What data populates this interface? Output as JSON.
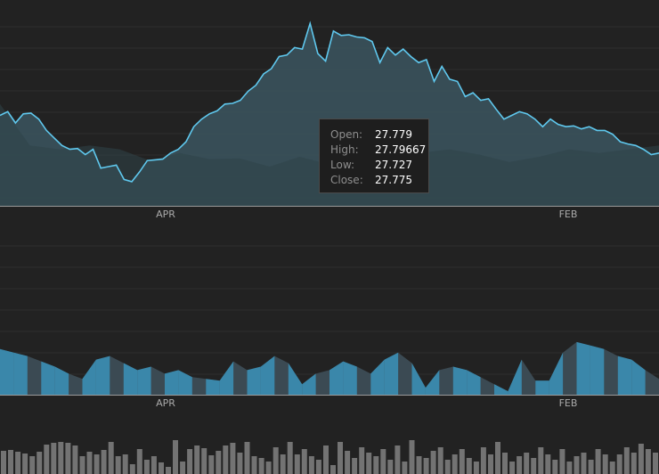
{
  "chart_data": [
    {
      "type": "area",
      "panel": "price",
      "x_tick_labels": [
        "APR",
        "FEB"
      ],
      "grid": true,
      "y_range": [
        26.2,
        28.6
      ],
      "close": [
        27.4,
        27.45,
        27.3,
        27.42,
        27.43,
        27.35,
        27.2,
        27.1,
        27.0,
        26.95,
        26.96,
        26.88,
        26.95,
        26.7,
        26.72,
        26.74,
        26.55,
        26.52,
        26.65,
        26.8,
        26.81,
        26.82,
        26.9,
        26.95,
        27.05,
        27.25,
        27.35,
        27.42,
        27.46,
        27.55,
        27.56,
        27.6,
        27.72,
        27.8,
        27.95,
        28.02,
        28.18,
        28.2,
        28.3,
        28.28,
        28.62,
        28.22,
        28.12,
        28.52,
        28.46,
        28.47,
        28.44,
        28.43,
        28.38,
        28.1,
        28.3,
        28.2,
        28.28,
        28.18,
        28.1,
        28.14,
        27.85,
        28.05,
        27.88,
        27.85,
        27.65,
        27.7,
        27.6,
        27.62,
        27.48,
        27.35,
        27.4,
        27.45,
        27.42,
        27.35,
        27.25,
        27.35,
        27.28,
        27.25,
        27.26,
        27.22,
        27.25,
        27.2,
        27.2,
        27.15,
        27.05,
        27.02,
        27.0,
        26.95,
        26.88,
        26.9
      ],
      "volume_overlay": [
        27.55,
        27.0,
        26.95,
        27.0,
        26.95,
        26.8,
        26.9,
        26.82,
        26.83,
        26.72,
        26.85,
        26.75,
        26.7,
        26.95,
        26.9,
        26.95,
        26.88,
        26.78,
        26.85,
        26.95,
        26.9,
        26.95,
        27.0
      ]
    },
    {
      "type": "area",
      "panel": "indicator",
      "x_tick_labels": [
        "APR",
        "FEB"
      ],
      "grid": true,
      "values": [
        62,
        60,
        58,
        55,
        52,
        48,
        45,
        56,
        58,
        54,
        50,
        52,
        48,
        50,
        46,
        45,
        44,
        55,
        50,
        52,
        58,
        54,
        42,
        48,
        50,
        55,
        52,
        48,
        56,
        60,
        54,
        40,
        50,
        52,
        50,
        46,
        42,
        38,
        56,
        44,
        44,
        60,
        66,
        64,
        62,
        58,
        56,
        50,
        45
      ]
    },
    {
      "type": "bar",
      "panel": "volume",
      "values": [
        26,
        27,
        25,
        23,
        20,
        25,
        33,
        35,
        36,
        35,
        32,
        20,
        25,
        22,
        27,
        36,
        20,
        22,
        11,
        28,
        16,
        20,
        13,
        8,
        38,
        14,
        28,
        32,
        29,
        21,
        26,
        32,
        35,
        24,
        36,
        20,
        18,
        14,
        30,
        22,
        36,
        22,
        28,
        20,
        16,
        32,
        10,
        36,
        26,
        18,
        30,
        24,
        20,
        28,
        16,
        32,
        14,
        38,
        20,
        18,
        26,
        30,
        16,
        22,
        28,
        18,
        14,
        30,
        22,
        36,
        24,
        14,
        20,
        24,
        18,
        30,
        22,
        16,
        28,
        14,
        20,
        24,
        16,
        28,
        22,
        14,
        22,
        30,
        24,
        34,
        28,
        24
      ]
    }
  ],
  "tooltip": {
    "open_label": "Open:",
    "open_value": "27.779",
    "high_label": "High:",
    "high_value": "27.79667",
    "low_label": "Low:",
    "low_value": "27.727",
    "close_label": "Close:",
    "close_value": "27.775"
  },
  "colors": {
    "background": "#222222",
    "grid": "#2f2f2f",
    "price_line": "#5fc8ee",
    "price_fill": "#3a525c",
    "indicator_fill": "#3a87aa",
    "indicator_shadow": "#3b4a53",
    "volume_bar": "#737373",
    "axis_line": "#9a9a9a"
  }
}
